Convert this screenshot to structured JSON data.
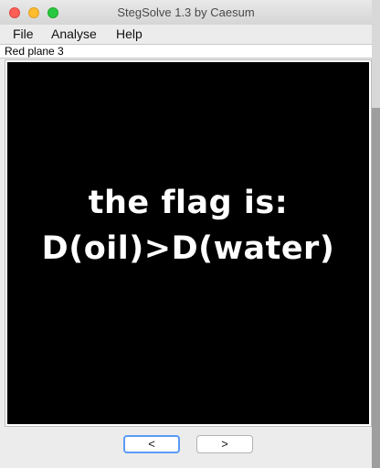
{
  "window": {
    "title": "StegSolve 1.3 by Caesum"
  },
  "menu": {
    "items": [
      "File",
      "Analyse",
      "Help"
    ]
  },
  "status": {
    "text": "Red plane 3"
  },
  "image": {
    "line1": "the flag is:",
    "line2": "D(oil)>D(water)"
  },
  "nav": {
    "prev_label": "<",
    "next_label": ">"
  },
  "colors": {
    "close": "#fd5f57",
    "minimize": "#febc2e",
    "maximize": "#28c840",
    "focus_ring": "#5a9bf5"
  }
}
